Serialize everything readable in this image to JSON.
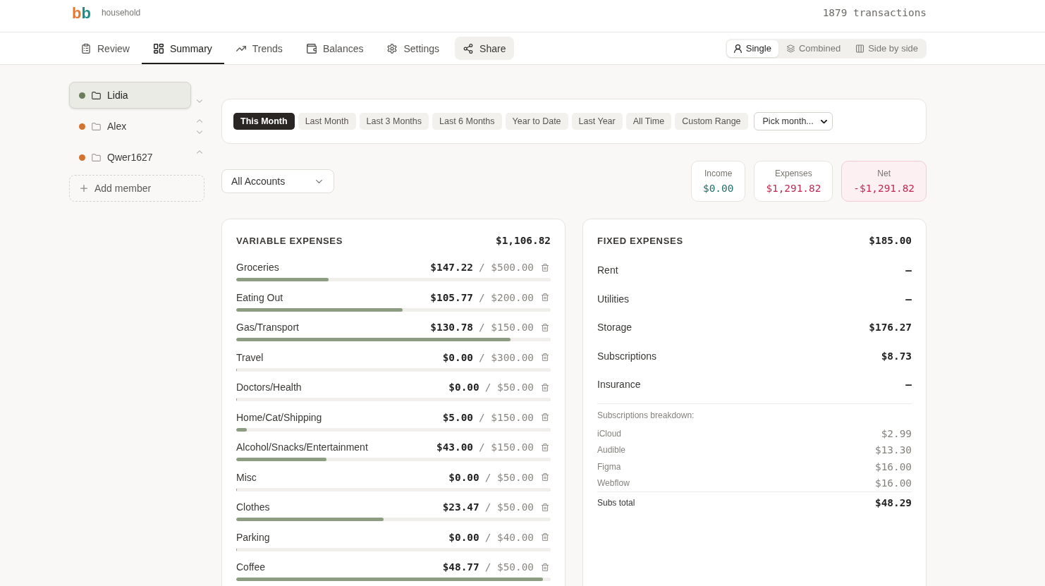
{
  "header": {
    "logo": "bb",
    "workspace": "household",
    "transaction_count": "1879 transactions"
  },
  "nav": {
    "tabs": [
      {
        "label": "Review",
        "selected": false
      },
      {
        "label": "Summary",
        "selected": true
      },
      {
        "label": "Trends",
        "selected": false
      },
      {
        "label": "Balances",
        "selected": false
      },
      {
        "label": "Settings",
        "selected": false
      }
    ],
    "share_button": {
      "label": "Share"
    }
  },
  "view_modes": [
    {
      "label": "Single",
      "selected": true
    },
    {
      "label": "Combined",
      "selected": false
    },
    {
      "label": "Side by side",
      "selected": false
    }
  ],
  "members": [
    {
      "name": "Lidia",
      "color": "#6b7d5e",
      "selected": true,
      "move_up": false,
      "move_down": true
    },
    {
      "name": "Alex",
      "color": "#d4722f",
      "selected": false,
      "move_up": true,
      "move_down": true
    },
    {
      "name": "Qwer1627",
      "color": "#d4722f",
      "selected": false,
      "move_up": true,
      "move_down": false
    }
  ],
  "add_member_button": {
    "label": "Add member"
  },
  "date_ranges": [
    {
      "label": "This Month",
      "selected": true
    },
    {
      "label": "Last Month",
      "selected": false
    },
    {
      "label": "Last 3 Months",
      "selected": false
    },
    {
      "label": "Last 6 Months",
      "selected": false
    },
    {
      "label": "Year to Date",
      "selected": false
    },
    {
      "label": "Last Year",
      "selected": false
    },
    {
      "label": "All Time",
      "selected": false
    },
    {
      "label": "Custom Range",
      "selected": false
    }
  ],
  "month_picker": {
    "value": "Pick month..."
  },
  "account_filter": {
    "value": "All Accounts"
  },
  "totals": [
    {
      "kind": "income",
      "label": "Income",
      "value": "$0.00"
    },
    {
      "kind": "expense",
      "label": "Expenses",
      "value": "$1,291.82"
    },
    {
      "kind": "net",
      "label": "Net",
      "value": "-$1,291.82"
    }
  ],
  "variable_expenses": {
    "title": "VARIABLE EXPENSES",
    "total": "$1,106.82",
    "categories": [
      {
        "name": "Groceries",
        "spent": "$147.22",
        "budget": "/ $500.00",
        "level": 0.294
      },
      {
        "name": "Eating Out",
        "spent": "$105.77",
        "budget": "/ $200.00",
        "level": 0.529
      },
      {
        "name": "Gas/Transport",
        "spent": "$130.78",
        "budget": "/ $150.00",
        "level": 0.872
      },
      {
        "name": "Travel",
        "spent": "$0.00",
        "budget": "/ $300.00",
        "level": 0
      },
      {
        "name": "Doctors/Health",
        "spent": "$0.00",
        "budget": "/ $50.00",
        "level": 0
      },
      {
        "name": "Home/Cat/Shipping",
        "spent": "$5.00",
        "budget": "/ $150.00",
        "level": 0.033
      },
      {
        "name": "Alcohol/Snacks/Entertainment",
        "spent": "$43.00",
        "budget": "/ $150.00",
        "level": 0.287
      },
      {
        "name": "Misc",
        "spent": "$0.00",
        "budget": "/ $50.00",
        "level": 0
      },
      {
        "name": "Clothes",
        "spent": "$23.47",
        "budget": "/ $50.00",
        "level": 0.469
      },
      {
        "name": "Parking",
        "spent": "$0.00",
        "budget": "/ $40.00",
        "level": 0
      },
      {
        "name": "Coffee",
        "spent": "$48.77",
        "budget": "/ $50.00",
        "level": 0.975
      }
    ]
  },
  "fixed_expenses": {
    "title": "FIXED EXPENSES",
    "total": "$185.00",
    "items": [
      {
        "name": "Rent",
        "value": "—"
      },
      {
        "name": "Utilities",
        "value": "—"
      },
      {
        "name": "Storage",
        "value": "$176.27"
      },
      {
        "name": "Subscriptions",
        "value": "$8.73"
      },
      {
        "name": "Insurance",
        "value": "—"
      }
    ],
    "breakdown": {
      "title": "Subscriptions breakdown:",
      "items": [
        {
          "name": "iCloud",
          "value": "$2.99"
        },
        {
          "name": "Audible",
          "value": "$13.30"
        },
        {
          "name": "Figma",
          "value": "$16.00"
        },
        {
          "name": "Webflow",
          "value": "$16.00"
        }
      ],
      "total_label": "Subs total",
      "total": "$48.29"
    }
  }
}
